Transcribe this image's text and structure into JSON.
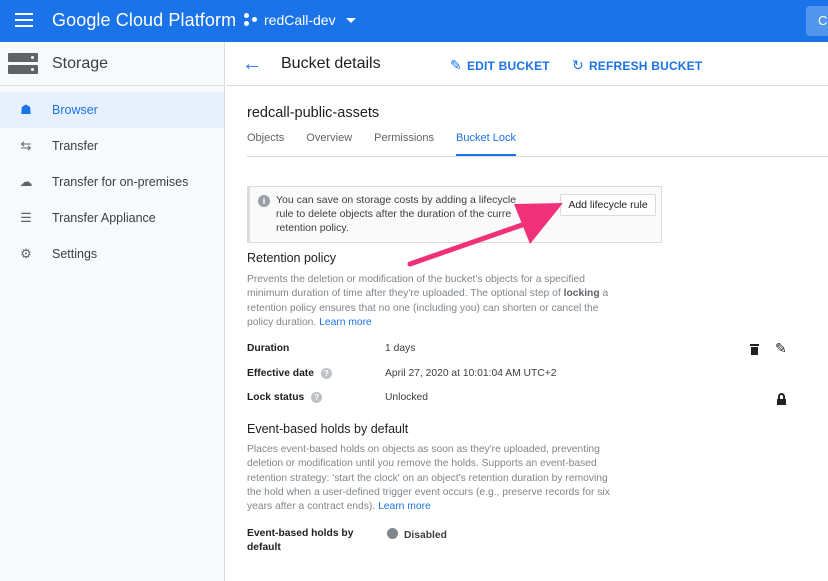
{
  "topbar": {
    "brand": "Google Cloud Platform",
    "project": "redCall-dev",
    "search_stub": "C"
  },
  "sidebar": {
    "title": "Storage",
    "items": [
      {
        "label": "Browser",
        "icon": "bucket-icon",
        "active": true
      },
      {
        "label": "Transfer",
        "icon": "transfer-arrows-icon"
      },
      {
        "label": "Transfer for on-premises",
        "icon": "cloud-upload-icon"
      },
      {
        "label": "Transfer Appliance",
        "icon": "appliance-list-icon"
      },
      {
        "label": "Settings",
        "icon": "gear-icon"
      }
    ]
  },
  "header": {
    "title": "Bucket details",
    "edit_label": "EDIT BUCKET",
    "refresh_label": "REFRESH BUCKET"
  },
  "bucket": {
    "name": "redcall-public-assets",
    "tabs": [
      "Objects",
      "Overview",
      "Permissions",
      "Bucket Lock"
    ],
    "active_tab": "Bucket Lock"
  },
  "notice": {
    "line1": "You can save on storage costs by adding a lifecycle",
    "line2": "rule to delete objects after the duration of the curre",
    "line3": "retention policy.",
    "button": "Add lifecycle rule"
  },
  "retention": {
    "title": "Retention policy",
    "desc_l1": "Prevents the deletion or modification of the bucket's objects for a specified",
    "desc_l2a": "minimum duration of time after they're uploaded. The optional step of ",
    "desc_l2b": "locking",
    "desc_l2c": " a",
    "desc_l3": "retention policy ensures that no one (including you) can shorten or cancel the",
    "desc_l4": "policy duration. ",
    "learn_more": "Learn more",
    "rows": [
      {
        "label": "Duration",
        "value": "1 days"
      },
      {
        "label": "Effective date",
        "value": "April 27, 2020 at 10:01:04 AM UTC+2"
      },
      {
        "label": "Lock status",
        "value": "Unlocked"
      }
    ]
  },
  "event_holds": {
    "title": "Event-based holds by default",
    "desc_l1": "Places event-based holds on objects as soon as they're uploaded, preventing",
    "desc_l2": "deletion or modification until you remove the holds. Supports an event-based",
    "desc_l3": "retention strategy: 'start the clock' on an object's retention duration by removing",
    "desc_l4": "the hold when a user-defined trigger event occurs (e.g., preserve records for six",
    "desc_l5": "years after a contract ends). ",
    "learn_more": "Learn more",
    "row_label_l1": "Event-based holds by",
    "row_label_l2": "default",
    "row_value": "Disabled"
  },
  "colors": {
    "accent": "#1a73e8",
    "annotation_arrow": "#f0317a"
  }
}
